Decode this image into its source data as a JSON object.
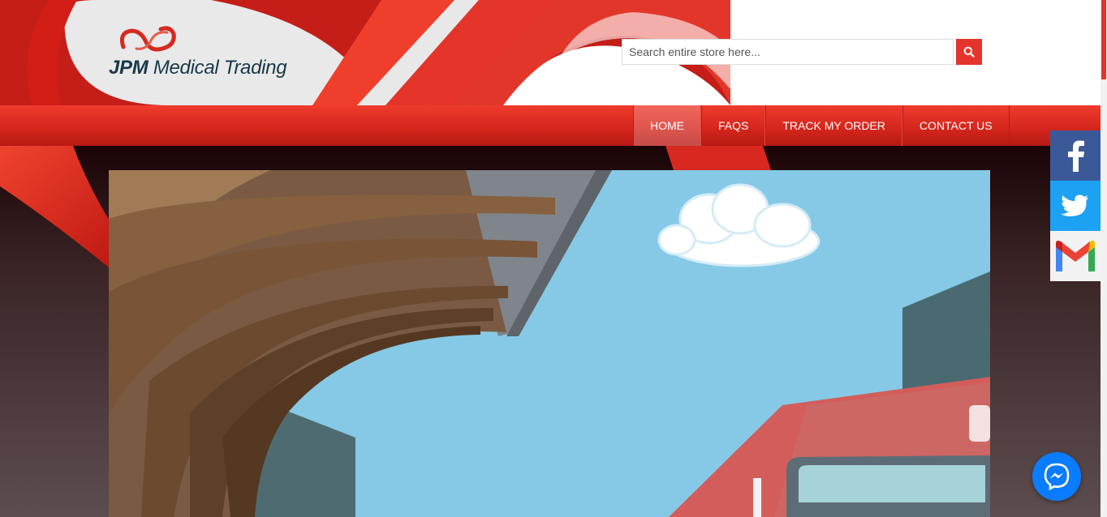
{
  "brand": {
    "logo_text_prefix": "JPM",
    "logo_text_suffix": " Medical Trading"
  },
  "search": {
    "placeholder": "Search entire store here...",
    "button_icon": "search-icon"
  },
  "nav": {
    "items": [
      {
        "label": "HOME",
        "active": true
      },
      {
        "label": "FAQS",
        "active": false
      },
      {
        "label": "TRACK MY ORDER",
        "active": false
      },
      {
        "label": "CONTACT US",
        "active": false
      }
    ]
  },
  "social": {
    "items": [
      {
        "name": "facebook-icon",
        "color": "#3b5998"
      },
      {
        "name": "twitter-icon",
        "color": "#1da1f2"
      },
      {
        "name": "gmail-icon",
        "color": "#f2f2f2"
      }
    ]
  },
  "chat": {
    "icon": "messenger-icon",
    "color": "#0a7cff"
  },
  "colors": {
    "accent": "#e4342b",
    "nav": "#d3251c",
    "logo_text": "#183848"
  }
}
